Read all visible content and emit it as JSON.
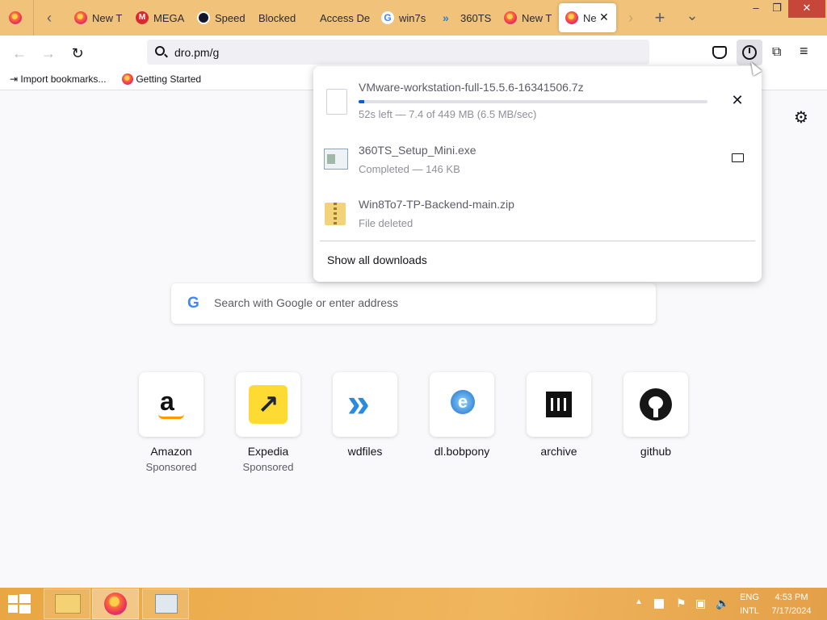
{
  "tabs": [
    {
      "label": "New T"
    },
    {
      "label": "MEGA"
    },
    {
      "label": "Speed"
    },
    {
      "label": "Blocked"
    },
    {
      "label": "Access De"
    },
    {
      "label": "win7s"
    },
    {
      "label": "360TS"
    },
    {
      "label": "New T"
    },
    {
      "label": "Ne"
    }
  ],
  "tab_controls": {
    "new_tab": "+",
    "list_all": "⌄",
    "scroll_left": "‹",
    "scroll_right": "›",
    "close_tab": "✕"
  },
  "window_controls": {
    "minimize": "–",
    "restore": "❐",
    "close": "✕"
  },
  "nav": {
    "url": "dro.pm/g"
  },
  "bookmarks": [
    {
      "label": "Import bookmarks..."
    },
    {
      "label": "Getting Started"
    }
  ],
  "downloads": {
    "items": [
      {
        "name": "VMware-workstation-full-15.5.6-16341506.7z",
        "status": "52s left — 7.4 of 449 MB (6.5 MB/sec)",
        "progress_fraction": 0.016,
        "icon": "file-icon",
        "action": "cancel-icon"
      },
      {
        "name": "360TS_Setup_Mini.exe",
        "status": "Completed — 146 KB",
        "icon": "exe-icon",
        "action": "folder-icon"
      },
      {
        "name": "Win8To7-TP-Backend-main.zip",
        "status": "File deleted",
        "icon": "zip-icon"
      }
    ],
    "show_all": "Show all downloads"
  },
  "newtab": {
    "search_placeholder": "Search with Google or enter address",
    "top_sites": [
      {
        "name": "Amazon",
        "sponsored": "Sponsored"
      },
      {
        "name": "Expedia",
        "sponsored": "Sponsored"
      },
      {
        "name": "wdfiles",
        "sponsored": ""
      },
      {
        "name": "dl.bobpony",
        "sponsored": ""
      },
      {
        "name": "archive",
        "sponsored": ""
      },
      {
        "name": "github",
        "sponsored": ""
      }
    ]
  },
  "taskbar": {
    "language": "ENG",
    "layout": "INTL",
    "time": "4:53 PM",
    "date": "7/17/2024"
  },
  "colors": {
    "accent": "#0061e0",
    "tabstrip": "#f0c27a",
    "taskbar": "#e9a743"
  }
}
